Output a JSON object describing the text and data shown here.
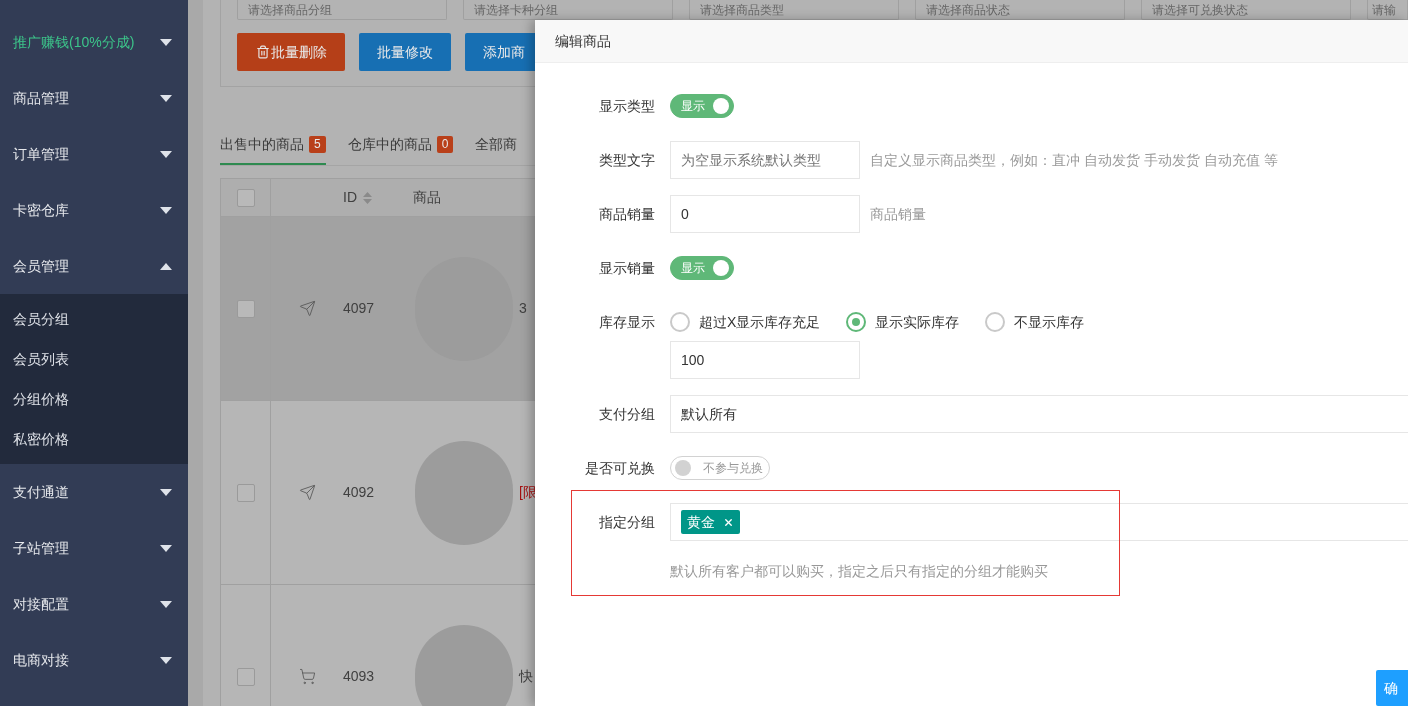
{
  "sidebar": {
    "items": [
      {
        "label": "推广赚钱(10%分成)",
        "kind": "promo",
        "expanded": false
      },
      {
        "label": "商品管理",
        "kind": "menu",
        "expanded": false
      },
      {
        "label": "订单管理",
        "kind": "menu",
        "expanded": false
      },
      {
        "label": "卡密仓库",
        "kind": "menu",
        "expanded": false
      },
      {
        "label": "会员管理",
        "kind": "menu",
        "expanded": true,
        "children": [
          {
            "label": "会员分组"
          },
          {
            "label": "会员列表"
          },
          {
            "label": "分组价格"
          },
          {
            "label": "私密价格"
          }
        ]
      },
      {
        "label": "支付通道",
        "kind": "menu",
        "expanded": false
      },
      {
        "label": "子站管理",
        "kind": "menu",
        "expanded": false
      },
      {
        "label": "对接配置",
        "kind": "menu",
        "expanded": false
      },
      {
        "label": "电商对接",
        "kind": "menu",
        "expanded": false
      }
    ]
  },
  "filters": [
    "请选择商品分组",
    "请选择卡种分组",
    "请选择商品类型",
    "请选择商品状态",
    "请选择可兑换状态",
    "请输"
  ],
  "buttons": [
    {
      "label": "批量删除",
      "kind": "danger"
    },
    {
      "label": "批量修改",
      "kind": "primary"
    },
    {
      "label": "添加商",
      "kind": "primary"
    }
  ],
  "tabs": [
    {
      "label": "出售中的商品",
      "count": "5",
      "selected": true
    },
    {
      "label": "仓库中的商品",
      "count": "0",
      "selected": false
    },
    {
      "label": "全部商",
      "selected": false
    }
  ],
  "table": {
    "select_all": false,
    "columns": [
      "ID",
      "商品"
    ],
    "rows": [
      {
        "checked": false,
        "kind": "plane",
        "id": "4097",
        "name": "3",
        "color": "#404040",
        "hovered": true
      },
      {
        "checked": false,
        "kind": "plane",
        "id": "4092",
        "name": "[限",
        "color": "#a51010",
        "hovered": false
      },
      {
        "checked": false,
        "kind": "cart",
        "id": "4093",
        "name": "快",
        "color": "#404040",
        "hovered": false
      }
    ]
  },
  "modal": {
    "title": "编辑商品",
    "fields": [
      {
        "kind": "switch",
        "label": "显示类型",
        "on": true,
        "text": "显示"
      },
      {
        "kind": "input",
        "label": "类型文字",
        "placeholder": "为空显示系统默认类型",
        "hint": "自定义显示商品类型，例如：直冲 自动发货 手动发货 自动充值 等"
      },
      {
        "kind": "input",
        "label": "商品销量",
        "value": "0",
        "hint": "商品销量"
      },
      {
        "kind": "switch",
        "label": "显示销量",
        "on": true,
        "text": "显示"
      },
      {
        "kind": "radio",
        "label": "库存显示",
        "options": [
          {
            "label": "超过X显示库存充足",
            "selected": false
          },
          {
            "label": "显示实际库存",
            "selected": true
          },
          {
            "label": "不显示库存",
            "selected": false
          }
        ],
        "value": "100"
      },
      {
        "kind": "select",
        "label": "支付分组",
        "value": "默认所有"
      },
      {
        "kind": "switch",
        "label": "是否可兑换",
        "on": false,
        "text": "不参与兑换"
      },
      {
        "kind": "tags",
        "label": "指定分组",
        "tags": [
          "黄金"
        ],
        "hint": "默认所有客户都可以购买，指定之后只有指定的分组才能购买",
        "outlined": true
      }
    ],
    "confirm": "确"
  }
}
